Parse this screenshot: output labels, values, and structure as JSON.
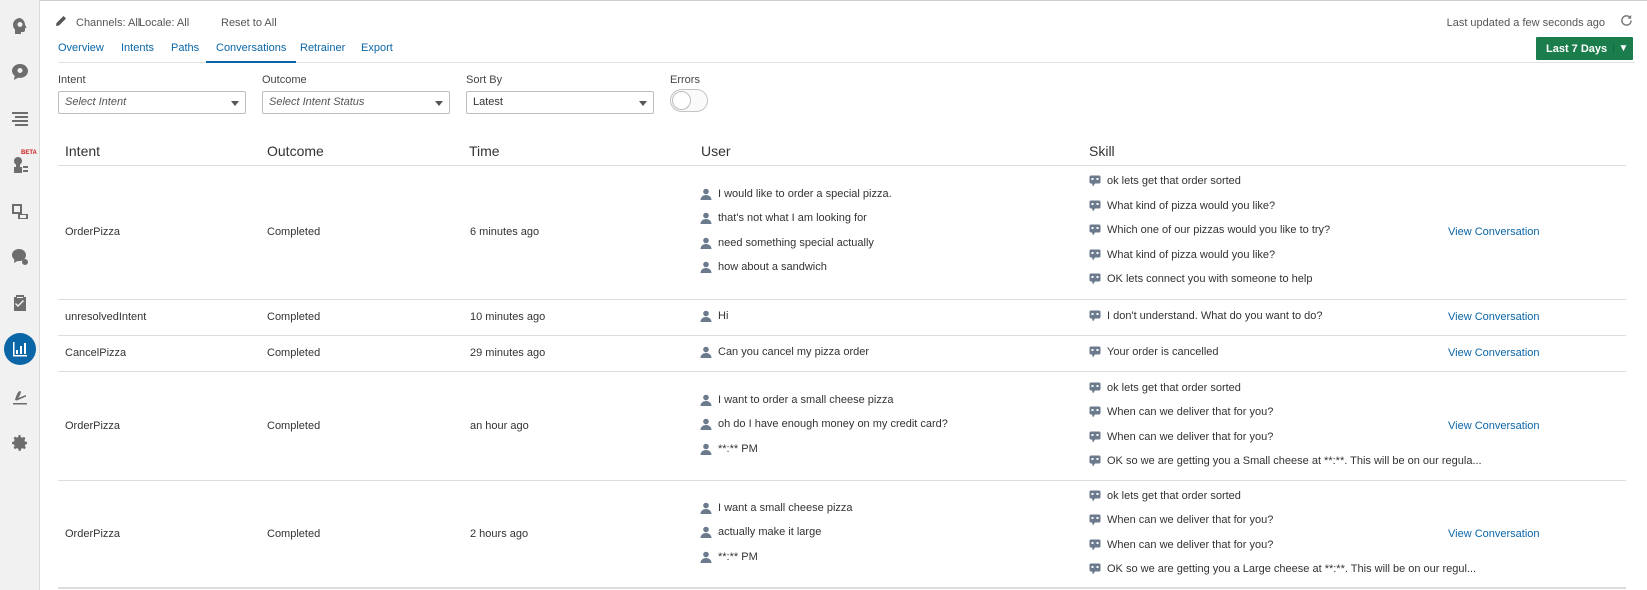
{
  "filters_bar": {
    "channels": "Channels: All",
    "locale": "Locale: All",
    "reset": "Reset to All",
    "last_updated_label": "Last updated",
    "last_updated_value": "a few seconds ago"
  },
  "tabs": [
    {
      "label": "Overview"
    },
    {
      "label": "Intents"
    },
    {
      "label": "Paths"
    },
    {
      "label": "Conversations"
    },
    {
      "label": "Retrainer"
    },
    {
      "label": "Export"
    }
  ],
  "active_tab": "Conversations",
  "date_range": {
    "label": "Last 7 Days"
  },
  "filters": {
    "intent": {
      "label": "Intent",
      "placeholder": "Select Intent"
    },
    "outcome": {
      "label": "Outcome",
      "placeholder": "Select Intent Status"
    },
    "sort": {
      "label": "Sort By",
      "value": "Latest"
    },
    "errors": {
      "label": "Errors",
      "enabled": false
    }
  },
  "rail": {
    "beta_label": "BETA"
  },
  "table": {
    "columns": [
      "Intent",
      "Outcome",
      "Time",
      "User",
      "Skill"
    ],
    "rows": [
      {
        "intent": "OrderPizza",
        "outcome": "Completed",
        "time": "6 minutes ago",
        "user": [
          "I would like to order a special pizza.",
          "that's not what I am looking for",
          "need something special actually",
          "how about a sandwich"
        ],
        "skill": [
          "ok lets get that order sorted",
          "What kind of pizza would you like?",
          "Which one of our pizzas would you like to try?",
          "What kind of pizza would you like?",
          "OK lets connect you with someone to help"
        ],
        "link": "View Conversation"
      },
      {
        "intent": "unresolvedIntent",
        "outcome": "Completed",
        "time": "10 minutes ago",
        "user": [
          "Hi"
        ],
        "skill": [
          "I don't understand. What do you want to do?"
        ],
        "link": "View Conversation"
      },
      {
        "intent": "CancelPizza",
        "outcome": "Completed",
        "time": "29 minutes ago",
        "user": [
          "Can you cancel my pizza order"
        ],
        "skill": [
          "Your order is cancelled"
        ],
        "link": "View Conversation"
      },
      {
        "intent": "OrderPizza",
        "outcome": "Completed",
        "time": "an hour ago",
        "user": [
          "I want to order a small cheese pizza",
          "oh do I have enough money on my credit card?",
          "**:** PM"
        ],
        "skill": [
          "ok lets get that order sorted",
          "When can we deliver that for you?",
          "When can we deliver that for you?",
          "OK so we are getting you a Small cheese at **:**. This will be on our regula..."
        ],
        "link": "View Conversation"
      },
      {
        "intent": "OrderPizza",
        "outcome": "Completed",
        "time": "2 hours ago",
        "user": [
          "I want a small cheese pizza",
          "actually make it large",
          "**:** PM"
        ],
        "skill": [
          "ok lets get that order sorted",
          "When can we deliver that for you?",
          "When can we deliver that for you?",
          "OK so we are getting you a Large cheese at **:**. This will be on our regul..."
        ],
        "link": "View Conversation"
      }
    ]
  }
}
